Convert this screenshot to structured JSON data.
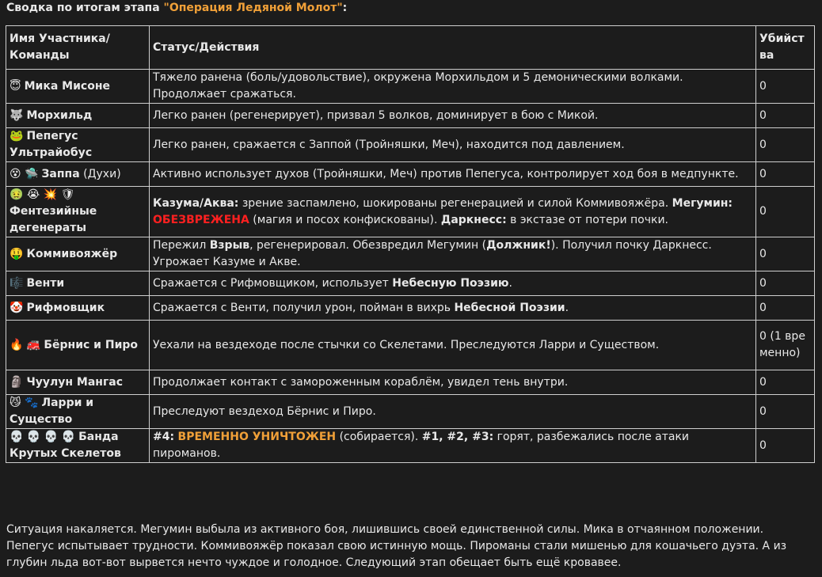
{
  "heading": {
    "prefix": "Сводка по итогам этапа ",
    "operation": "\"Операция Ледяной Молот\"",
    "suffix": ":"
  },
  "table": {
    "headers": {
      "name": "Имя Участника/ Команды",
      "status": "Статус/Действия",
      "kills": "Убийства"
    },
    "rows": [
      {
        "emoji": "😇",
        "name": "Мика Мисоне",
        "status": [
          {
            "t": "Тяжело ранена (боль/удовольствие), окружена Морхильдом и 5 демоническими волками. Продолжает сражаться."
          }
        ],
        "kills": "0"
      },
      {
        "emoji": "🐺",
        "name": "Морхильд",
        "status": [
          {
            "t": "Легко ранен (регенерирует), призвал 5 волков, доминирует в бою с Микой."
          }
        ],
        "kills": "0"
      },
      {
        "emoji": "🐸",
        "name": "Пепегус Ультрайобус",
        "status": [
          {
            "t": "Легко ранен, сражается с Заппой (Тройняшки, Меч), находится под давлением."
          }
        ],
        "kills": "0"
      },
      {
        "emoji": "😵 🛸",
        "name": "Заппа",
        "name_extra": " (Духи)",
        "status": [
          {
            "t": "Активно использует духов (Тройняшки, Меч) против Пепегуса, контролирует ход боя в медпункте."
          }
        ],
        "kills": "0"
      },
      {
        "emoji": "🤢 😭 💥 🛡",
        "name": "Фентезийные дегенераты",
        "status": [
          {
            "t": "Казума/Аква:",
            "s": "b"
          },
          {
            "t": " зрение заспамлено, шокированы регенерацией и силой Коммивояжёра. "
          },
          {
            "t": "Мегумин:",
            "s": "b"
          },
          {
            "t": " "
          },
          {
            "t": "ОБЕЗВРЕЖЕНА",
            "s": "red"
          },
          {
            "t": " (магия и посох конфискованы). "
          },
          {
            "t": "Даркнесс:",
            "s": "b"
          },
          {
            "t": " в экстазе от потери почки."
          }
        ],
        "kills": "0"
      },
      {
        "emoji": "🤑",
        "name": "Коммивояжёр",
        "status": [
          {
            "t": "Пережил "
          },
          {
            "t": "Взрыв",
            "s": "b"
          },
          {
            "t": ", регенерировал. Обезвредил Мегумин ("
          },
          {
            "t": "Должник!",
            "s": "b"
          },
          {
            "t": "). Получил почку Даркнесс. Угрожает Казуме и Акве."
          }
        ],
        "kills": "0"
      },
      {
        "emoji": "🎼",
        "name": "Венти",
        "status": [
          {
            "t": "Сражается с Рифмовщиком, использует "
          },
          {
            "t": "Небесную Поэзию",
            "s": "b"
          },
          {
            "t": "."
          }
        ],
        "kills": "0"
      },
      {
        "emoji": "🤡",
        "name": "Рифмовщик",
        "status": [
          {
            "t": "Сражается с Венти, получил урон, пойман в вихрь "
          },
          {
            "t": "Небесной Поэзии",
            "s": "b"
          },
          {
            "t": "."
          }
        ],
        "kills": "0"
      },
      {
        "emoji": "🔥 🚒",
        "name": "Бёрнис и Пиро",
        "status": [
          {
            "t": "Уехали на вездеходе после стычки со Скелетами. Преследуются Ларри и Существом."
          }
        ],
        "kills": "0 (1 временно)"
      },
      {
        "emoji": "🗿",
        "name": "Чуулун Мангас",
        "status": [
          {
            "t": "Продолжает контакт с замороженным кораблём, увидел тень внутри."
          }
        ],
        "kills": "0"
      },
      {
        "emoji": "😼 🐾",
        "name": "Ларри и Существо",
        "status": [
          {
            "t": "Преследуют вездеход Бёрнис и Пиро."
          }
        ],
        "kills": "0"
      },
      {
        "emoji": "💀 💀 💀 💀",
        "name": "Банда Крутых Скелетов",
        "status": [
          {
            "t": "#4:",
            "s": "b"
          },
          {
            "t": " "
          },
          {
            "t": "ВРЕМЕННО УНИЧТОЖЕН",
            "s": "orange"
          },
          {
            "t": " (собирается). "
          },
          {
            "t": "#1, #2, #3:",
            "s": "b"
          },
          {
            "t": " горят, разбежались после атаки пироманов."
          }
        ],
        "kills": "0"
      }
    ]
  },
  "footer": {
    "text": "Ситуация накаляется. Мегумин выбыла из активного боя, лишившись своей единственной силы. Мика в отчаянном положении. Пепегус испытывает трудности. Коммивояжёр показал свою истинную мощь. Пироманы стали мишенью для кошачьего дуэта. А из глубин льда вот-вот вырвется нечто чуждое и голодное. Следующий этап обещает быть ещё кровавее."
  },
  "colors": {
    "background": "#1c1c1c",
    "text": "#e8e8e8",
    "accent_orange": "#f0a038",
    "accent_red": "#ff2020",
    "border": "#cfcfcf"
  }
}
